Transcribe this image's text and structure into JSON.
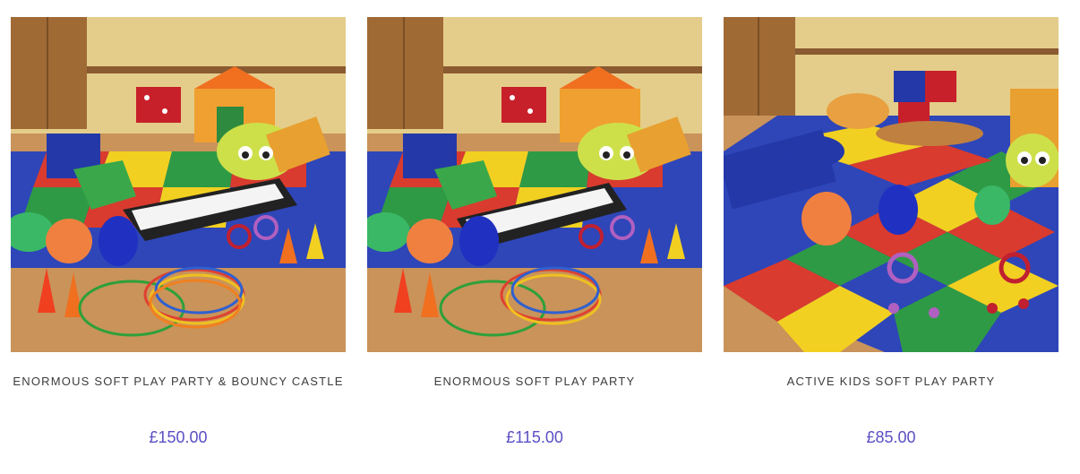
{
  "colors": {
    "title_text": "#3c3c3c",
    "price_text": "#5b4fc4",
    "background": "#ffffff"
  },
  "products": [
    {
      "title": "ENORMOUS SOFT PLAY PARTY & BOUNCY CASTLE",
      "price": "£150.00",
      "image_alt": "Soft play equipment with mats, play tunnel, piano mat, bouncy animals, cones and hoops"
    },
    {
      "title": "ENORMOUS SOFT PLAY PARTY",
      "price": "£115.00",
      "image_alt": "Soft play equipment with mats, play tunnel, piano mat, bouncy animals, cones and hoops"
    },
    {
      "title": "ACTIVE KIDS SOFT PLAY PARTY",
      "price": "£85.00",
      "image_alt": "Colourful soft play mats with caterpillar tunnel, dice blocks, bouncy animals and ride-on bugs"
    }
  ]
}
